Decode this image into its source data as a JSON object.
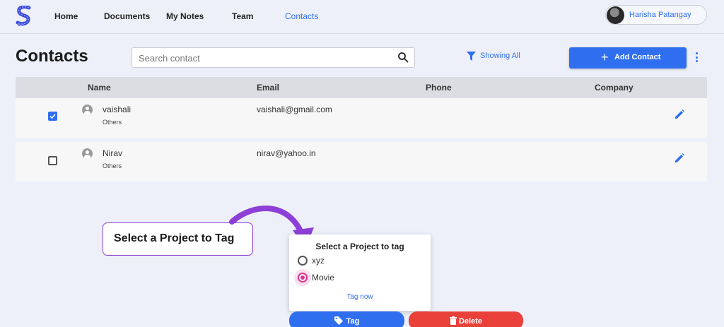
{
  "nav": {
    "items": [
      {
        "label": "Home",
        "active": false
      },
      {
        "label": "Documents",
        "active": false
      },
      {
        "label": "My Notes",
        "active": false
      },
      {
        "label": "Team",
        "active": false
      },
      {
        "label": "Contacts",
        "active": true
      }
    ],
    "user_name": "Harisha Patangay"
  },
  "header": {
    "title": "Contacts",
    "search_placeholder": "Search contact",
    "filter_label": "Showing All",
    "add_button_label": "Add Contact"
  },
  "table": {
    "columns": [
      "Name",
      "Email",
      "Phone",
      "Company"
    ],
    "rows": [
      {
        "checked": true,
        "name": "vaishali",
        "tag": "Others",
        "email": "vaishali@gmail.com",
        "phone": "",
        "company": ""
      },
      {
        "checked": false,
        "name": "Nirav",
        "tag": "Others",
        "email": "nirav@yahoo.in",
        "phone": "",
        "company": ""
      }
    ]
  },
  "callout": {
    "text": "Select a Project to Tag"
  },
  "popup": {
    "title": "Select a Project to tag",
    "options": [
      {
        "label": "xyz",
        "selected": false
      },
      {
        "label": "Movie",
        "selected": true
      }
    ],
    "action_label": "Tag now"
  },
  "actions": {
    "tag_label": "Tag",
    "delete_label": "Delete"
  },
  "colors": {
    "accent": "#2f6fef",
    "delete": "#e9403a",
    "callout_border": "#8d3fd6",
    "radio_selected": "#e0318f"
  },
  "icons": [
    "app-logo",
    "search-icon",
    "filter-icon",
    "plus-icon",
    "more-vert-icon",
    "person-icon",
    "edit-icon",
    "tag-icon",
    "trash-icon",
    "curved-arrow-icon"
  ]
}
